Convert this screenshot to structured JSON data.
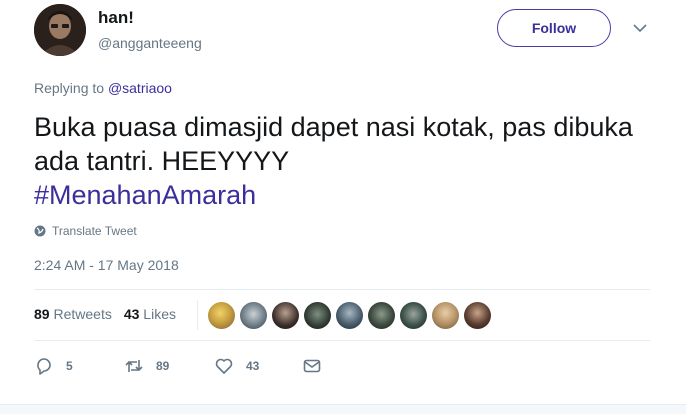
{
  "user": {
    "display_name": "han!",
    "screen_name": "@angganteeeng"
  },
  "follow_label": "Follow",
  "reply_context": {
    "prefix": "Replying to",
    "mention": "@satriaoo"
  },
  "tweet": {
    "text": "Buka puasa dimasjid dapet nasi kotak, pas dibuka ada tantri. HEEYYYY",
    "hashtag": "#MenahanAmarah"
  },
  "translate_label": "Translate Tweet",
  "timestamp": "2:24 AM - 17 May 2018",
  "stats": {
    "retweets_count": "89",
    "retweets_label": "Retweets",
    "likes_count": "43",
    "likes_label": "Likes"
  },
  "actions": {
    "reply_count": "5",
    "retweet_count": "89",
    "like_count": "43"
  },
  "colors": {
    "accent": "#3b2f9c",
    "muted": "#657786"
  }
}
